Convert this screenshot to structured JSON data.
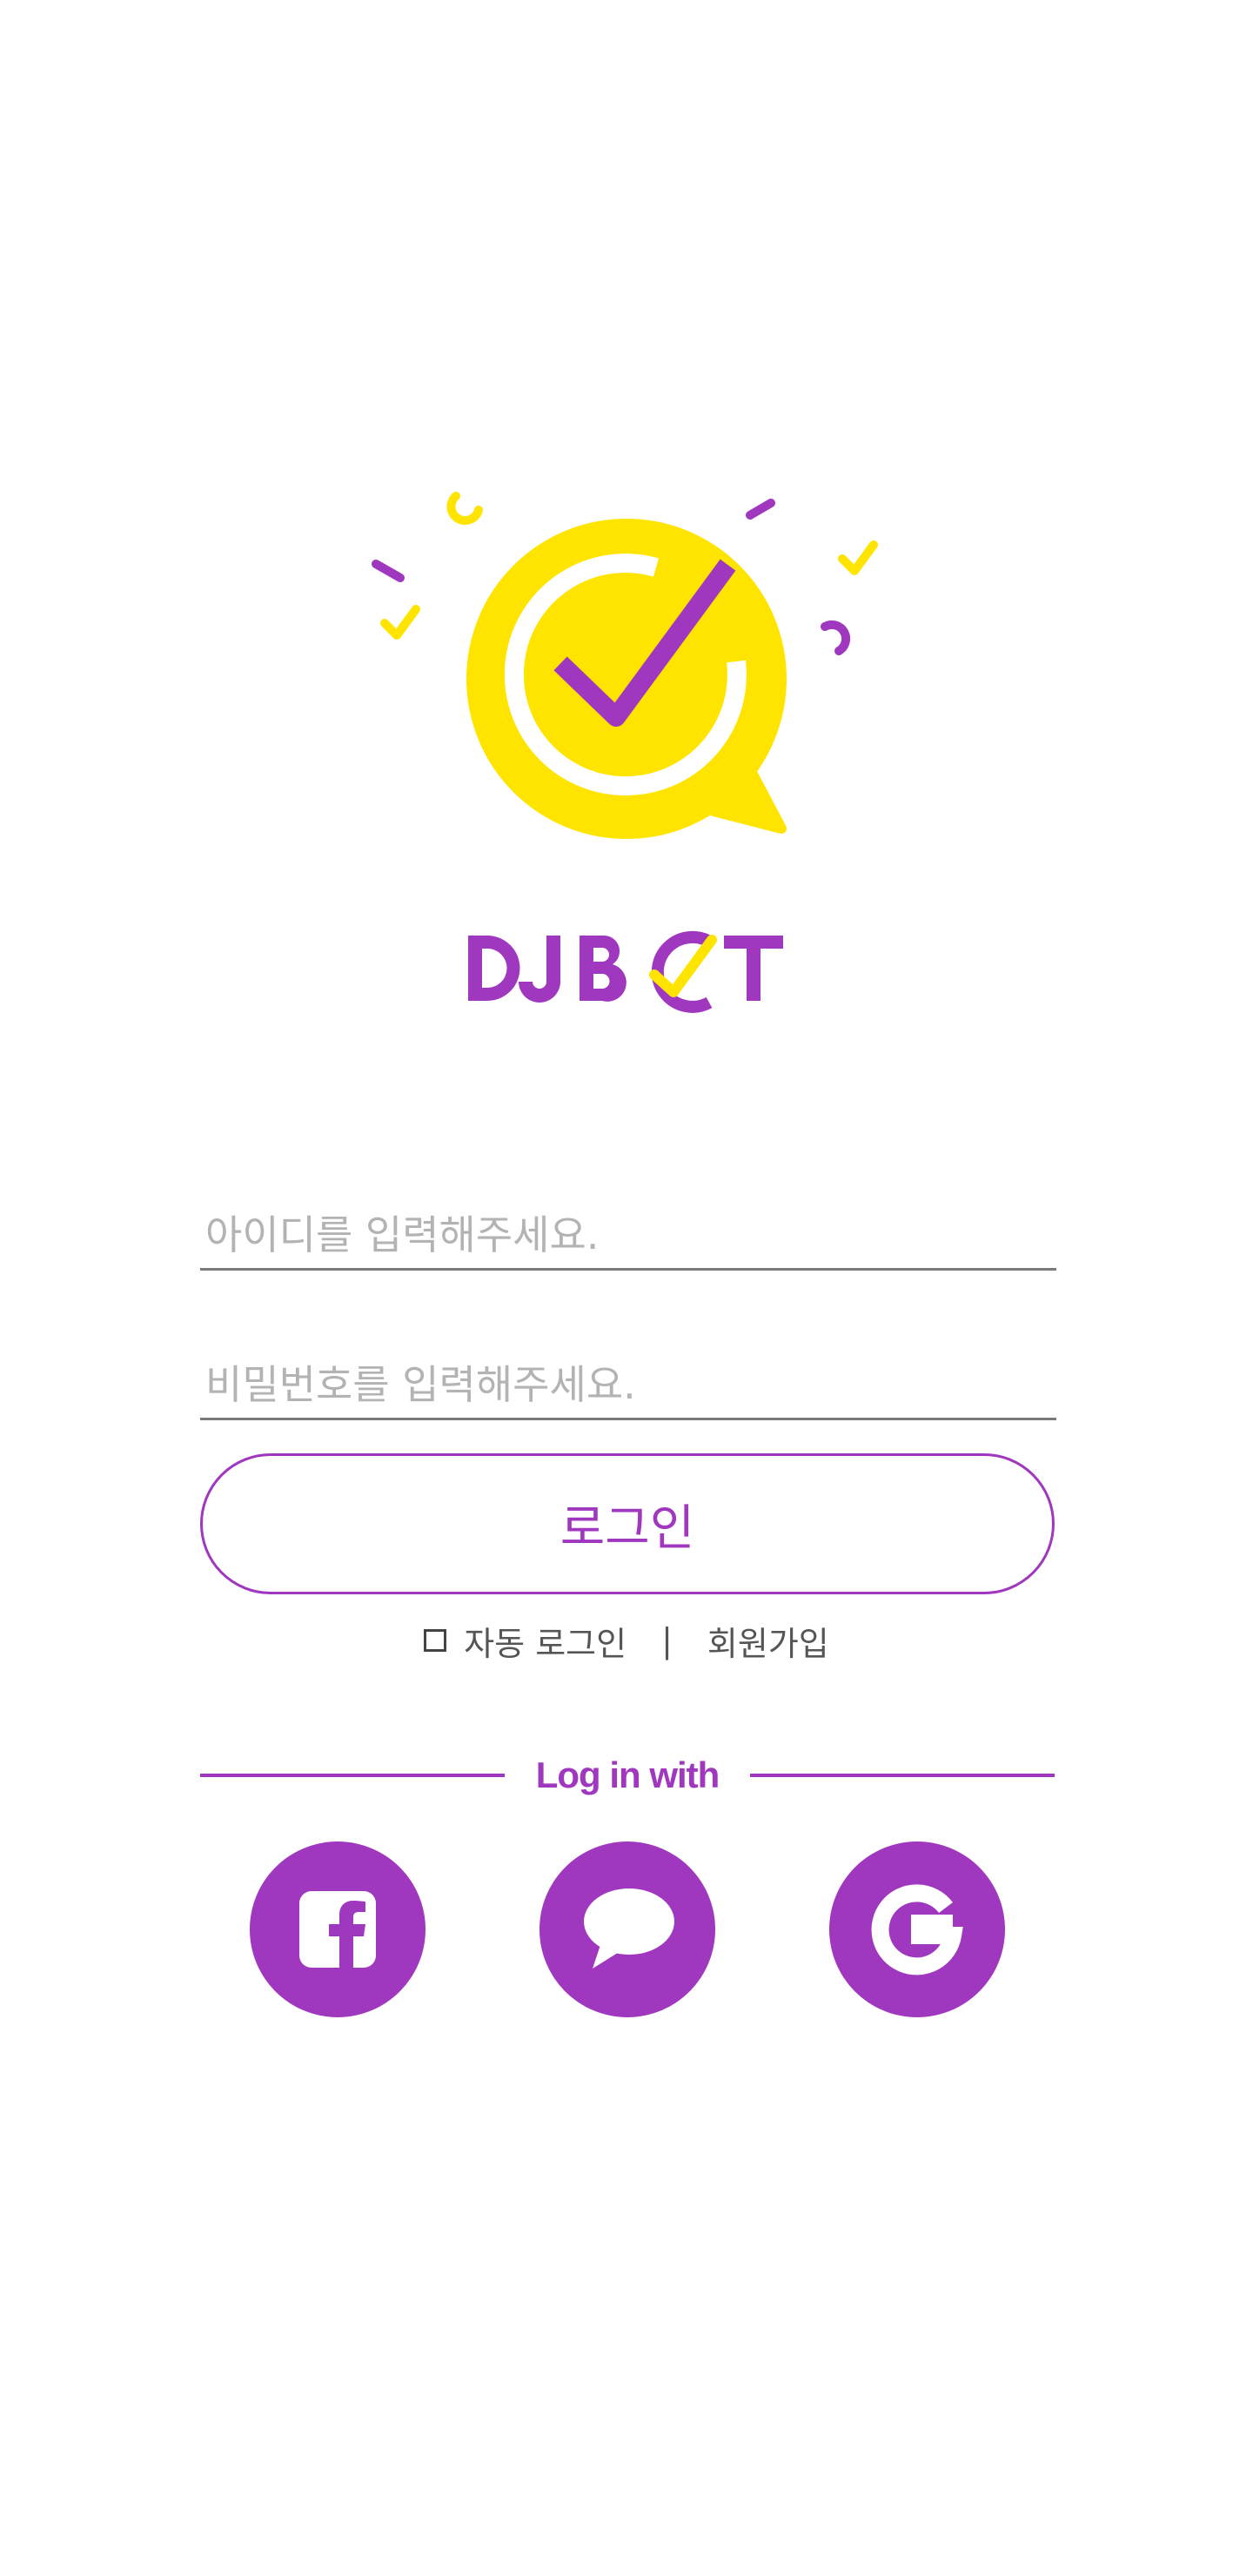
{
  "brand": {
    "name": "DJBOT",
    "colors": {
      "primary": "#a037bf",
      "accent": "#ffe400"
    }
  },
  "login_form": {
    "id_placeholder": "아이디를 입력해주세요.",
    "password_placeholder": "비밀번호를 입력해주세요.",
    "login_button_label": "로그인",
    "auto_login_label": "자동 로그인",
    "divider": "|",
    "signup_label": "회원가입"
  },
  "social_login": {
    "heading": "Log in with",
    "providers": [
      {
        "name": "facebook",
        "icon": "facebook-icon"
      },
      {
        "name": "kakao",
        "icon": "speech-bubble-icon"
      },
      {
        "name": "google",
        "icon": "google-g-icon"
      }
    ]
  }
}
